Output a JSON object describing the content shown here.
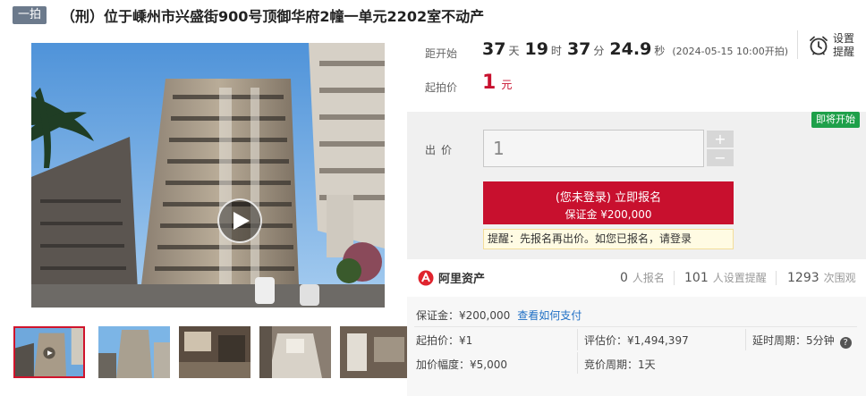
{
  "header": {
    "round_badge": "一拍",
    "title": "（刑）位于嵊州市兴盛街900号顶御华府2幢一单元2202室不动产"
  },
  "media": {
    "main_image_alt": "",
    "thumbnails_count": 5,
    "active_thumbnail": 1
  },
  "countdown": {
    "label": "距开始",
    "days": "37",
    "days_unit": "天",
    "hours": "19",
    "hours_unit": "时",
    "minutes": "37",
    "minutes_unit": "分",
    "seconds": "24.9",
    "seconds_unit": "秒",
    "start_time": "(2024-05-15 10:00开拍)"
  },
  "reminder": {
    "label": "设置提醒",
    "icon": "alarm-clock-icon"
  },
  "start_price": {
    "label": "起拍价",
    "value": "1",
    "unit": "元"
  },
  "bid": {
    "status_badge": "即将开始",
    "label": "出价",
    "input_value": "1",
    "plus": "+",
    "minus": "−",
    "register_line1": "(您未登录) 立即报名",
    "register_line2": "保证金 ¥200,000",
    "notice_prefix": "提醒：先报名再出价。如您已报名，请",
    "notice_link": "登录"
  },
  "platform": {
    "name": "阿里资产",
    "registered_count": "0",
    "registered_unit": "人报名",
    "reminders_count": "101",
    "reminders_unit": "人设置提醒",
    "views_count": "1293",
    "views_unit": "次围观"
  },
  "details": {
    "deposit": "保证金：¥200,000",
    "how_to_pay": "查看如何支付",
    "start_price": "起拍价：¥1",
    "appraisal": "评估价：¥1,494,397",
    "extension": "延时周期：5分钟",
    "increment": "加价幅度：¥5,000",
    "auction_period": "竞价周期：1天"
  },
  "colors": {
    "accent_red": "#c8102e",
    "status_green": "#1ea04a",
    "link_blue": "#1f6fc5",
    "badge_gray": "#6c7a8c"
  }
}
